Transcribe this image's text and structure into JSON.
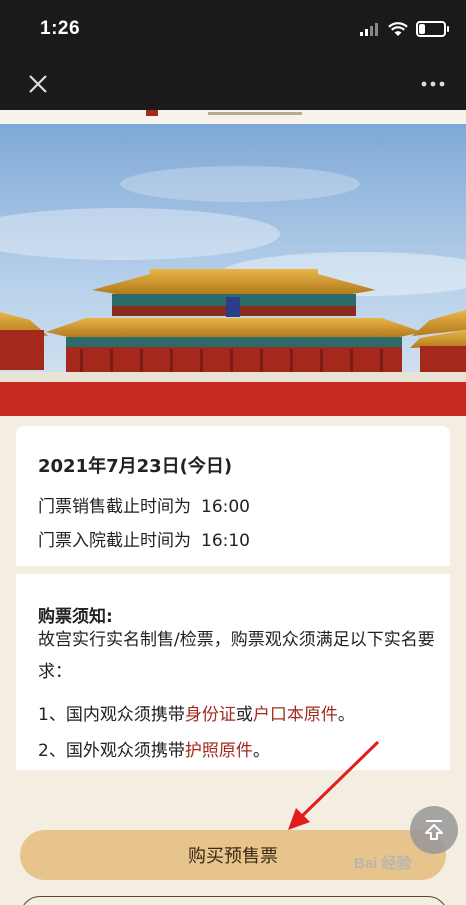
{
  "status_bar": {
    "time": "1:26"
  },
  "nav": {
    "close_icon": "close-icon",
    "more_icon": "more-dots-icon"
  },
  "ticket_info": {
    "date": "2021年7月23日(今日)",
    "sale_deadline_label": "门票销售截止时间为",
    "sale_deadline_time": "16:00",
    "entry_deadline_label": "门票入院截止时间为",
    "entry_deadline_time": "16:10"
  },
  "notice": {
    "title": "购票须知:",
    "text": "故宫实行实名制售/检票，购票观众须满足以下实名要求：",
    "rule1_prefix": "1、国内观众须携带",
    "rule1_id_card": "身份证",
    "rule1_or": "或",
    "rule1_household": "户口本原件",
    "rule1_end": "。",
    "rule2_prefix": "2、国外观众须携带",
    "rule2_passport": "护照原件",
    "rule2_end": "。"
  },
  "actions": {
    "buy_label": "购买预售票",
    "scroll_top_icon": "scroll-to-top-icon"
  },
  "watermark": {
    "text": "Bai 经验"
  },
  "colors": {
    "accent": "#a32a1c",
    "button": "#e8c48d",
    "page_bg": "#f4ede2"
  }
}
